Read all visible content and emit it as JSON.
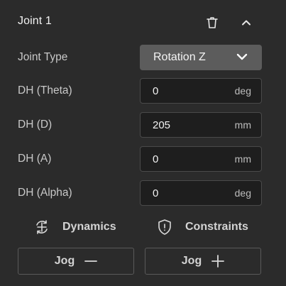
{
  "joint": {
    "title": "Joint 1",
    "delete_icon": "trash-icon",
    "collapse_icon": "chevron-up-icon"
  },
  "joint_type": {
    "label": "Joint Type",
    "value": "Rotation Z",
    "icon": "chevron-down-icon"
  },
  "params": [
    {
      "label": "DH (Theta)",
      "value": "0",
      "unit": "deg"
    },
    {
      "label": "DH (D)",
      "value": "205",
      "unit": "mm"
    },
    {
      "label": "DH (A)",
      "value": "0",
      "unit": "mm"
    },
    {
      "label": "DH (Alpha)",
      "value": "0",
      "unit": "deg"
    }
  ],
  "features": {
    "dynamics": {
      "label": "Dynamics",
      "icon": "dynamics-icon"
    },
    "constraints": {
      "label": "Constraints",
      "icon": "shield-alert-icon"
    }
  },
  "jog": {
    "minus_label": "Jog",
    "plus_label": "Jog",
    "minus_icon": "minus-icon",
    "plus_icon": "plus-icon"
  },
  "colors": {
    "background": "#2b2b2b",
    "field_background": "#1e1e1e",
    "select_background": "#5c5c5c",
    "border": "#4a4a4a",
    "text": "#ececec"
  }
}
